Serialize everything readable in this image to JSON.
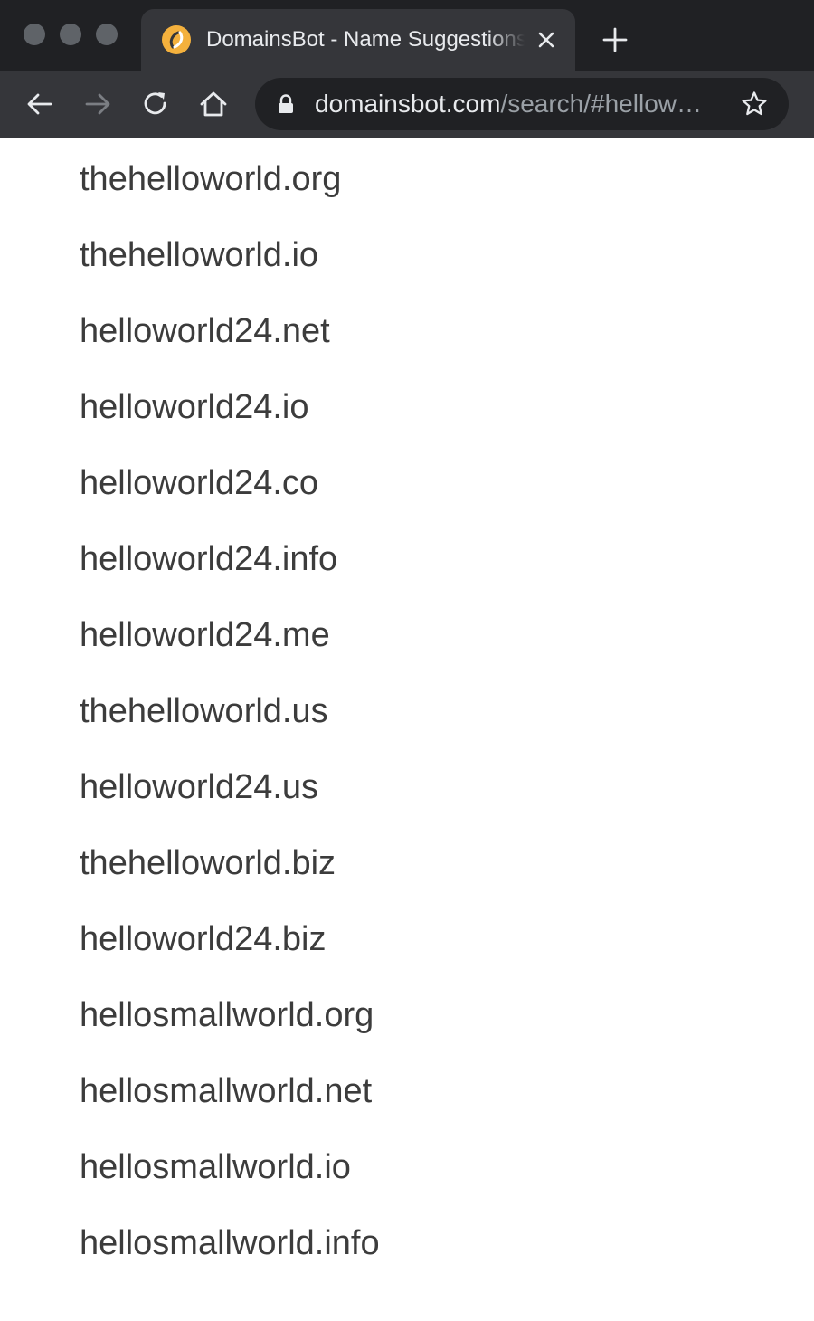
{
  "browser": {
    "tab": {
      "title": "DomainsBot - Name Suggestions",
      "favicon": "domainsbot-logo-icon",
      "close_icon": "close-icon"
    },
    "new_tab_icon": "plus-icon",
    "nav": {
      "back_icon": "arrow-left-icon",
      "forward_icon": "arrow-right-icon",
      "reload_icon": "reload-icon",
      "home_icon": "home-icon"
    },
    "address_bar": {
      "host": "domainsbot.com",
      "path": "/search/#hellow…",
      "lock_icon": "lock-icon",
      "bookmark_icon": "star-icon"
    }
  },
  "results": [
    "thehelloworld.org",
    "thehelloworld.io",
    "helloworld24.net",
    "helloworld24.io",
    "helloworld24.co",
    "helloworld24.info",
    "helloworld24.me",
    "thehelloworld.us",
    "helloworld24.us",
    "thehelloworld.biz",
    "helloworld24.biz",
    "hellosmallworld.org",
    "hellosmallworld.net",
    "hellosmallworld.io",
    "hellosmallworld.info"
  ],
  "colors": {
    "chrome_dark": "#202124",
    "chrome_tab": "#35363a",
    "favicon_orange": "#f4b13d",
    "result_text": "#3c3c3c",
    "divider": "#dcdcdc"
  }
}
